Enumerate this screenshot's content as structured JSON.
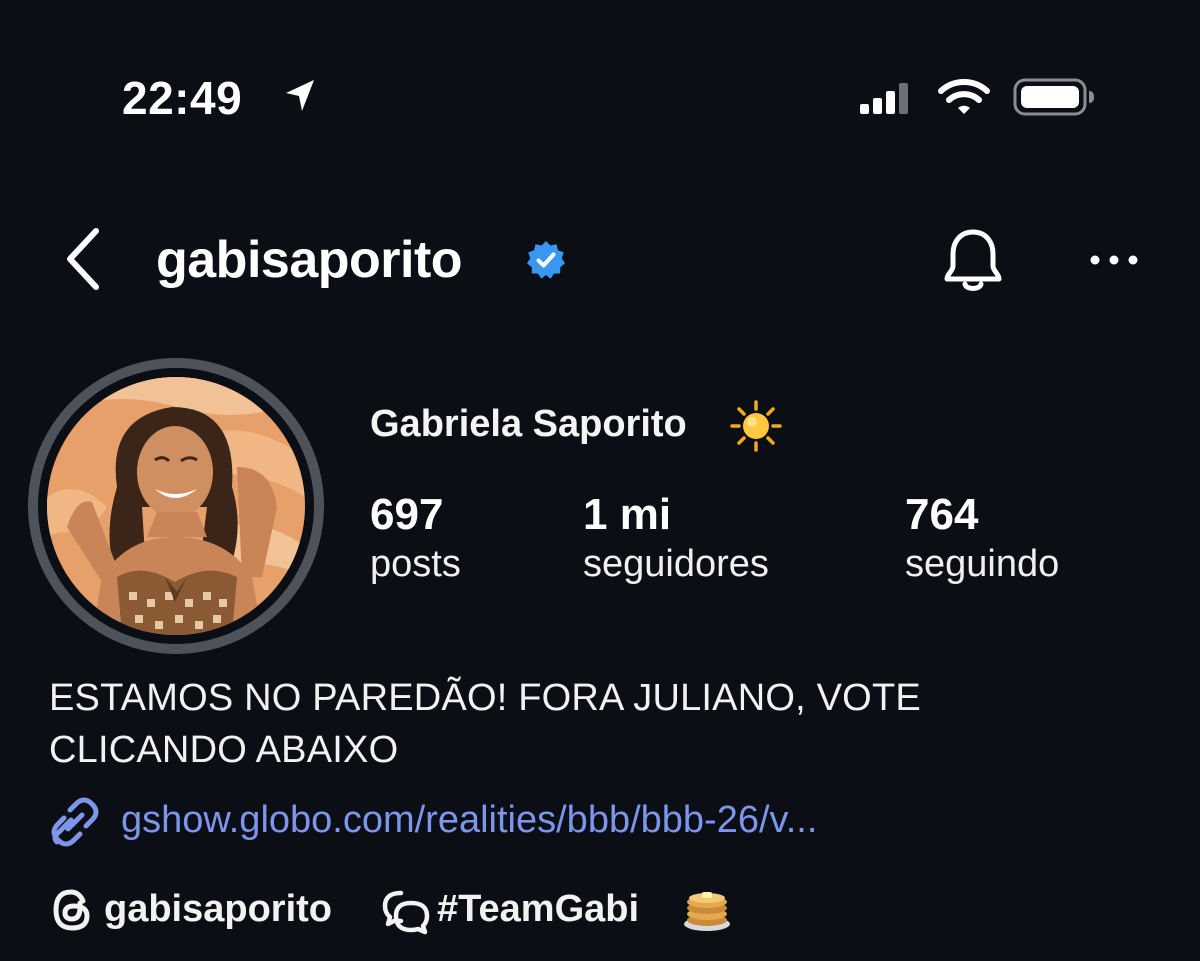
{
  "status_bar": {
    "time": "22:49",
    "icons": [
      "location-arrow-icon",
      "cellular-signal-icon",
      "wifi-icon",
      "battery-icon"
    ]
  },
  "header": {
    "username": "gabisaporito",
    "verified": true,
    "back_icon": "chevron-left-icon",
    "notification_icon": "bell-icon",
    "more_icon": "ellipsis-icon"
  },
  "profile": {
    "full_name": "Gabriela Saporito",
    "name_emoji": "sun-emoji",
    "stats": [
      {
        "value": "697",
        "label": "posts"
      },
      {
        "value": "1 mi",
        "label": "seguidores"
      },
      {
        "value": "764",
        "label": "seguindo"
      }
    ],
    "bio_line1": "ESTAMOS NO PAREDÃO! FORA JULIANO, VOTE",
    "bio_line2": "CLICANDO ABAIXO",
    "link": "gshow.globo.com/realities/bbb/bbb-26/v...",
    "threads_handle": "gabisaporito",
    "broadcast_channel": "#TeamGabi",
    "channel_emoji": "pancakes-emoji"
  },
  "colors": {
    "background": "#0b0e14",
    "verified_blue": "#3897f0",
    "link_blue": "#7d95ea",
    "text": "#f2f2f2"
  }
}
